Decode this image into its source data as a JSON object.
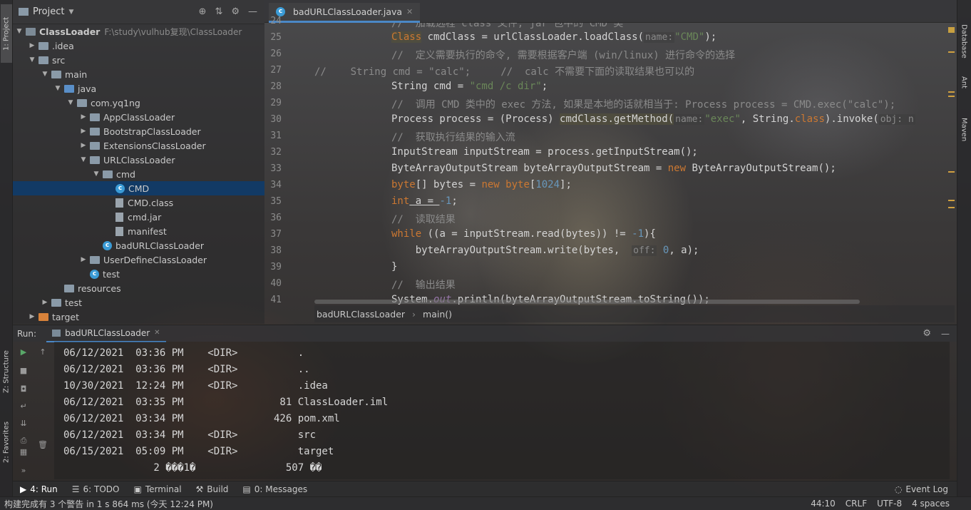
{
  "left_strip": {
    "project_tab": "1: Project",
    "structure_tab": "Z: Structure",
    "favorites_tab": "2: Favorites"
  },
  "right_strip": {
    "database_tab": "Database",
    "ant_tab": "Ant",
    "maven_tab": "Maven"
  },
  "project_panel": {
    "title": "Project",
    "tree": [
      {
        "label": "ClassLoader",
        "extra": "F:\\study\\vulhub复现\\ClassLoader",
        "depth": 0,
        "arrow": "open",
        "icon": "folder-dark",
        "bold": true
      },
      {
        "label": ".idea",
        "depth": 1,
        "arrow": "closed",
        "icon": "folder"
      },
      {
        "label": "src",
        "depth": 1,
        "arrow": "open",
        "icon": "folder"
      },
      {
        "label": "main",
        "depth": 2,
        "arrow": "open",
        "icon": "folder"
      },
      {
        "label": "java",
        "depth": 3,
        "arrow": "open",
        "icon": "folder-blue"
      },
      {
        "label": "com.yq1ng",
        "depth": 4,
        "arrow": "open",
        "icon": "folder"
      },
      {
        "label": "AppClassLoader",
        "depth": 5,
        "arrow": "closed",
        "icon": "folder"
      },
      {
        "label": "BootstrapClassLoader",
        "depth": 5,
        "arrow": "closed",
        "icon": "folder"
      },
      {
        "label": "ExtensionsClassLoader",
        "depth": 5,
        "arrow": "closed",
        "icon": "folder"
      },
      {
        "label": "URLClassLoader",
        "depth": 5,
        "arrow": "open",
        "icon": "folder"
      },
      {
        "label": "cmd",
        "depth": 6,
        "arrow": "open",
        "icon": "folder"
      },
      {
        "label": "CMD",
        "depth": 7,
        "arrow": "none",
        "icon": "class",
        "selected": true
      },
      {
        "label": "CMD.class",
        "depth": 7,
        "arrow": "none",
        "icon": "file"
      },
      {
        "label": "cmd.jar",
        "depth": 7,
        "arrow": "none",
        "icon": "file"
      },
      {
        "label": "manifest",
        "depth": 7,
        "arrow": "none",
        "icon": "file"
      },
      {
        "label": "badURLClassLoader",
        "depth": 6,
        "arrow": "none",
        "icon": "class"
      },
      {
        "label": "UserDefineClassLoader",
        "depth": 5,
        "arrow": "closed",
        "icon": "folder"
      },
      {
        "label": "test",
        "depth": 5,
        "arrow": "none",
        "icon": "class"
      },
      {
        "label": "resources",
        "depth": 3,
        "arrow": "none",
        "icon": "folder"
      },
      {
        "label": "test",
        "depth": 2,
        "arrow": "closed",
        "icon": "folder"
      },
      {
        "label": "target",
        "depth": 1,
        "arrow": "closed",
        "icon": "folder-orange"
      }
    ]
  },
  "editor": {
    "tab_label": "badURLClassLoader.java",
    "line_numbers": [
      "24",
      "25",
      "26",
      "27",
      "28",
      "29",
      "30",
      "31",
      "32",
      "33",
      "34",
      "35",
      "36",
      "37",
      "38",
      "39",
      "40",
      "41"
    ],
    "breadcrumb": [
      "badURLClassLoader",
      "main()"
    ],
    "code": {
      "l24": "//  加载远程 class 文件, jar 包中的 CMD 类",
      "l25_a": "Class",
      "l25_b": " cmdClass = urlClassLoader.loadClass(",
      "l25_hint": "name:",
      "l25_str": "\"CMD\"",
      "l25_c": ");",
      "l26": "//  定义需要执行的命令, 需要根据客户端 (win/linux) 进行命令的选择",
      "l27": "//    String cmd = \"calc\";     //  calc 不需要下面的读取结果也可以的",
      "l28_a": "String cmd = ",
      "l28_str": "\"cmd /c dir\"",
      "l28_c": ";",
      "l29": "//  调用 CMD 类中的 exec 方法, 如果是本地的话就相当于: Process process = CMD.exec(\"calc\");",
      "l30_a": "Process process = (Process) ",
      "l30_hl": "cmdClass.getMethod(",
      "l30_hint": "name:",
      "l30_str": "\"exec\"",
      "l30_b": ", String.",
      "l30_kw": "class",
      "l30_c": ").invoke(",
      "l30_hint2": "obj: n",
      "l31": "//  获取执行结果的输入流",
      "l32": "InputStream inputStream = process.getInputStream();",
      "l33_a": "ByteArrayOutputStream byteArrayOutputStream = ",
      "l33_kw": "new",
      "l33_b": " ByteArrayOutputStream();",
      "l34_kw1": "byte",
      "l34_a": "[] bytes = ",
      "l34_kw2": "new",
      "l34_kw3": " byte",
      "l34_b": "[",
      "l34_num": "1024",
      "l34_c": "];",
      "l35_kw": "int",
      "l35_a": " a = ",
      "l35_num": "-1",
      "l35_b": ";",
      "l36": "//  读取结果",
      "l37_kw": "while",
      "l37_a": " ((a = inputStream.read(bytes)) != ",
      "l37_num": "-1",
      "l37_b": "){",
      "l38_a": "    byteArrayOutputStream.write(bytes,  ",
      "l38_hint": "off:",
      "l38_num": " 0",
      "l38_b": ", a);",
      "l39": "}",
      "l40": "//  输出结果",
      "l41_a": "System.",
      "l41_out": "out",
      "l41_b": ".println(byteArrayOutputStream.toString());"
    }
  },
  "run_panel": {
    "label": "Run:",
    "tab_label": "badURLClassLoader",
    "console_lines": [
      "06/12/2021  03:36 PM    <DIR>          .",
      "06/12/2021  03:36 PM    <DIR>          ..",
      "10/30/2021  12:24 PM    <DIR>          .idea",
      "06/12/2021  03:35 PM                81 ClassLoader.iml",
      "06/12/2021  03:34 PM               426 pom.xml",
      "06/12/2021  03:34 PM    <DIR>          src",
      "06/15/2021  05:09 PM    <DIR>          target",
      "               2 ���1�               507 ��"
    ]
  },
  "bottom_toolbar": {
    "items": [
      "4: Run",
      "6: TODO",
      "Terminal",
      "Build",
      "0: Messages"
    ],
    "event_log": "Event Log"
  },
  "status_bar": {
    "message": "构建完成有 3 个警告 in 1 s 864 ms (今天 12:24 PM)",
    "position": "44:10",
    "line_sep": "CRLF",
    "encoding": "UTF-8",
    "indent": "4 spaces"
  }
}
